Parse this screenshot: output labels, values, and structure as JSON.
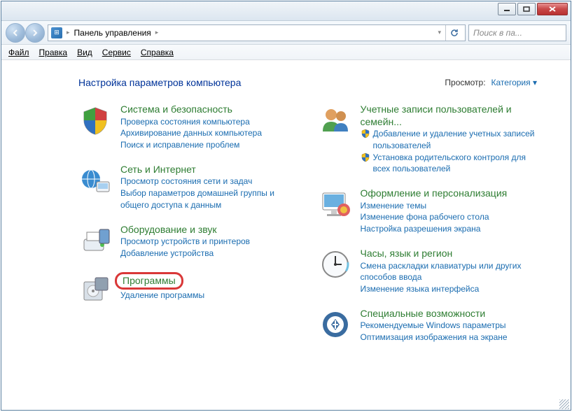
{
  "titlebar": {},
  "navbar": {
    "breadcrumb": "Панель управления",
    "search_placeholder": "Поиск в па..."
  },
  "menu": {
    "file": "Файл",
    "edit": "Правка",
    "view": "Вид",
    "tools": "Сервис",
    "help": "Справка"
  },
  "header": {
    "title": "Настройка параметров компьютера",
    "view_label": "Просмотр:",
    "view_value": "Категория"
  },
  "left": [
    {
      "title": "Система и безопасность",
      "links": [
        "Проверка состояния компьютера",
        "Архивирование данных компьютера",
        "Поиск и исправление проблем"
      ]
    },
    {
      "title": "Сеть и Интернет",
      "links": [
        "Просмотр состояния сети и задач",
        "Выбор параметров домашней группы и общего доступа к данным"
      ]
    },
    {
      "title": "Оборудование и звук",
      "links": [
        "Просмотр устройств и принтеров",
        "Добавление устройства"
      ]
    },
    {
      "title": "Программы",
      "links": [
        "Удаление программы"
      ],
      "highlight": true
    }
  ],
  "right": [
    {
      "title": "Учетные записи пользователей и семейн...",
      "links": [
        {
          "text": "Добавление и удаление учетных записей пользователей",
          "shield": true
        },
        {
          "text": "Установка родительского контроля для всех пользователей",
          "shield": true
        }
      ]
    },
    {
      "title": "Оформление и персонализация",
      "links": [
        "Изменение темы",
        "Изменение фона рабочего стола",
        "Настройка разрешения экрана"
      ]
    },
    {
      "title": "Часы, язык и регион",
      "links": [
        "Смена раскладки клавиатуры или других способов ввода",
        "Изменение языка интерфейса"
      ]
    },
    {
      "title": "Специальные возможности",
      "links": [
        "Рекомендуемые Windows параметры",
        "Оптимизация изображения на экране"
      ]
    }
  ],
  "icons": {
    "colors": {
      "shield_y": "#f0c020",
      "shield_b": "#3070c0",
      "shield_g": "#40a040",
      "shield_r": "#d04040",
      "net": "#3a8cd0",
      "hw": "#70a0d0",
      "prog": "#90a0b0",
      "user": "#e0a060",
      "appear": "#e06060",
      "clock": "#70c0e0",
      "acc": "#3a6ca0"
    }
  }
}
